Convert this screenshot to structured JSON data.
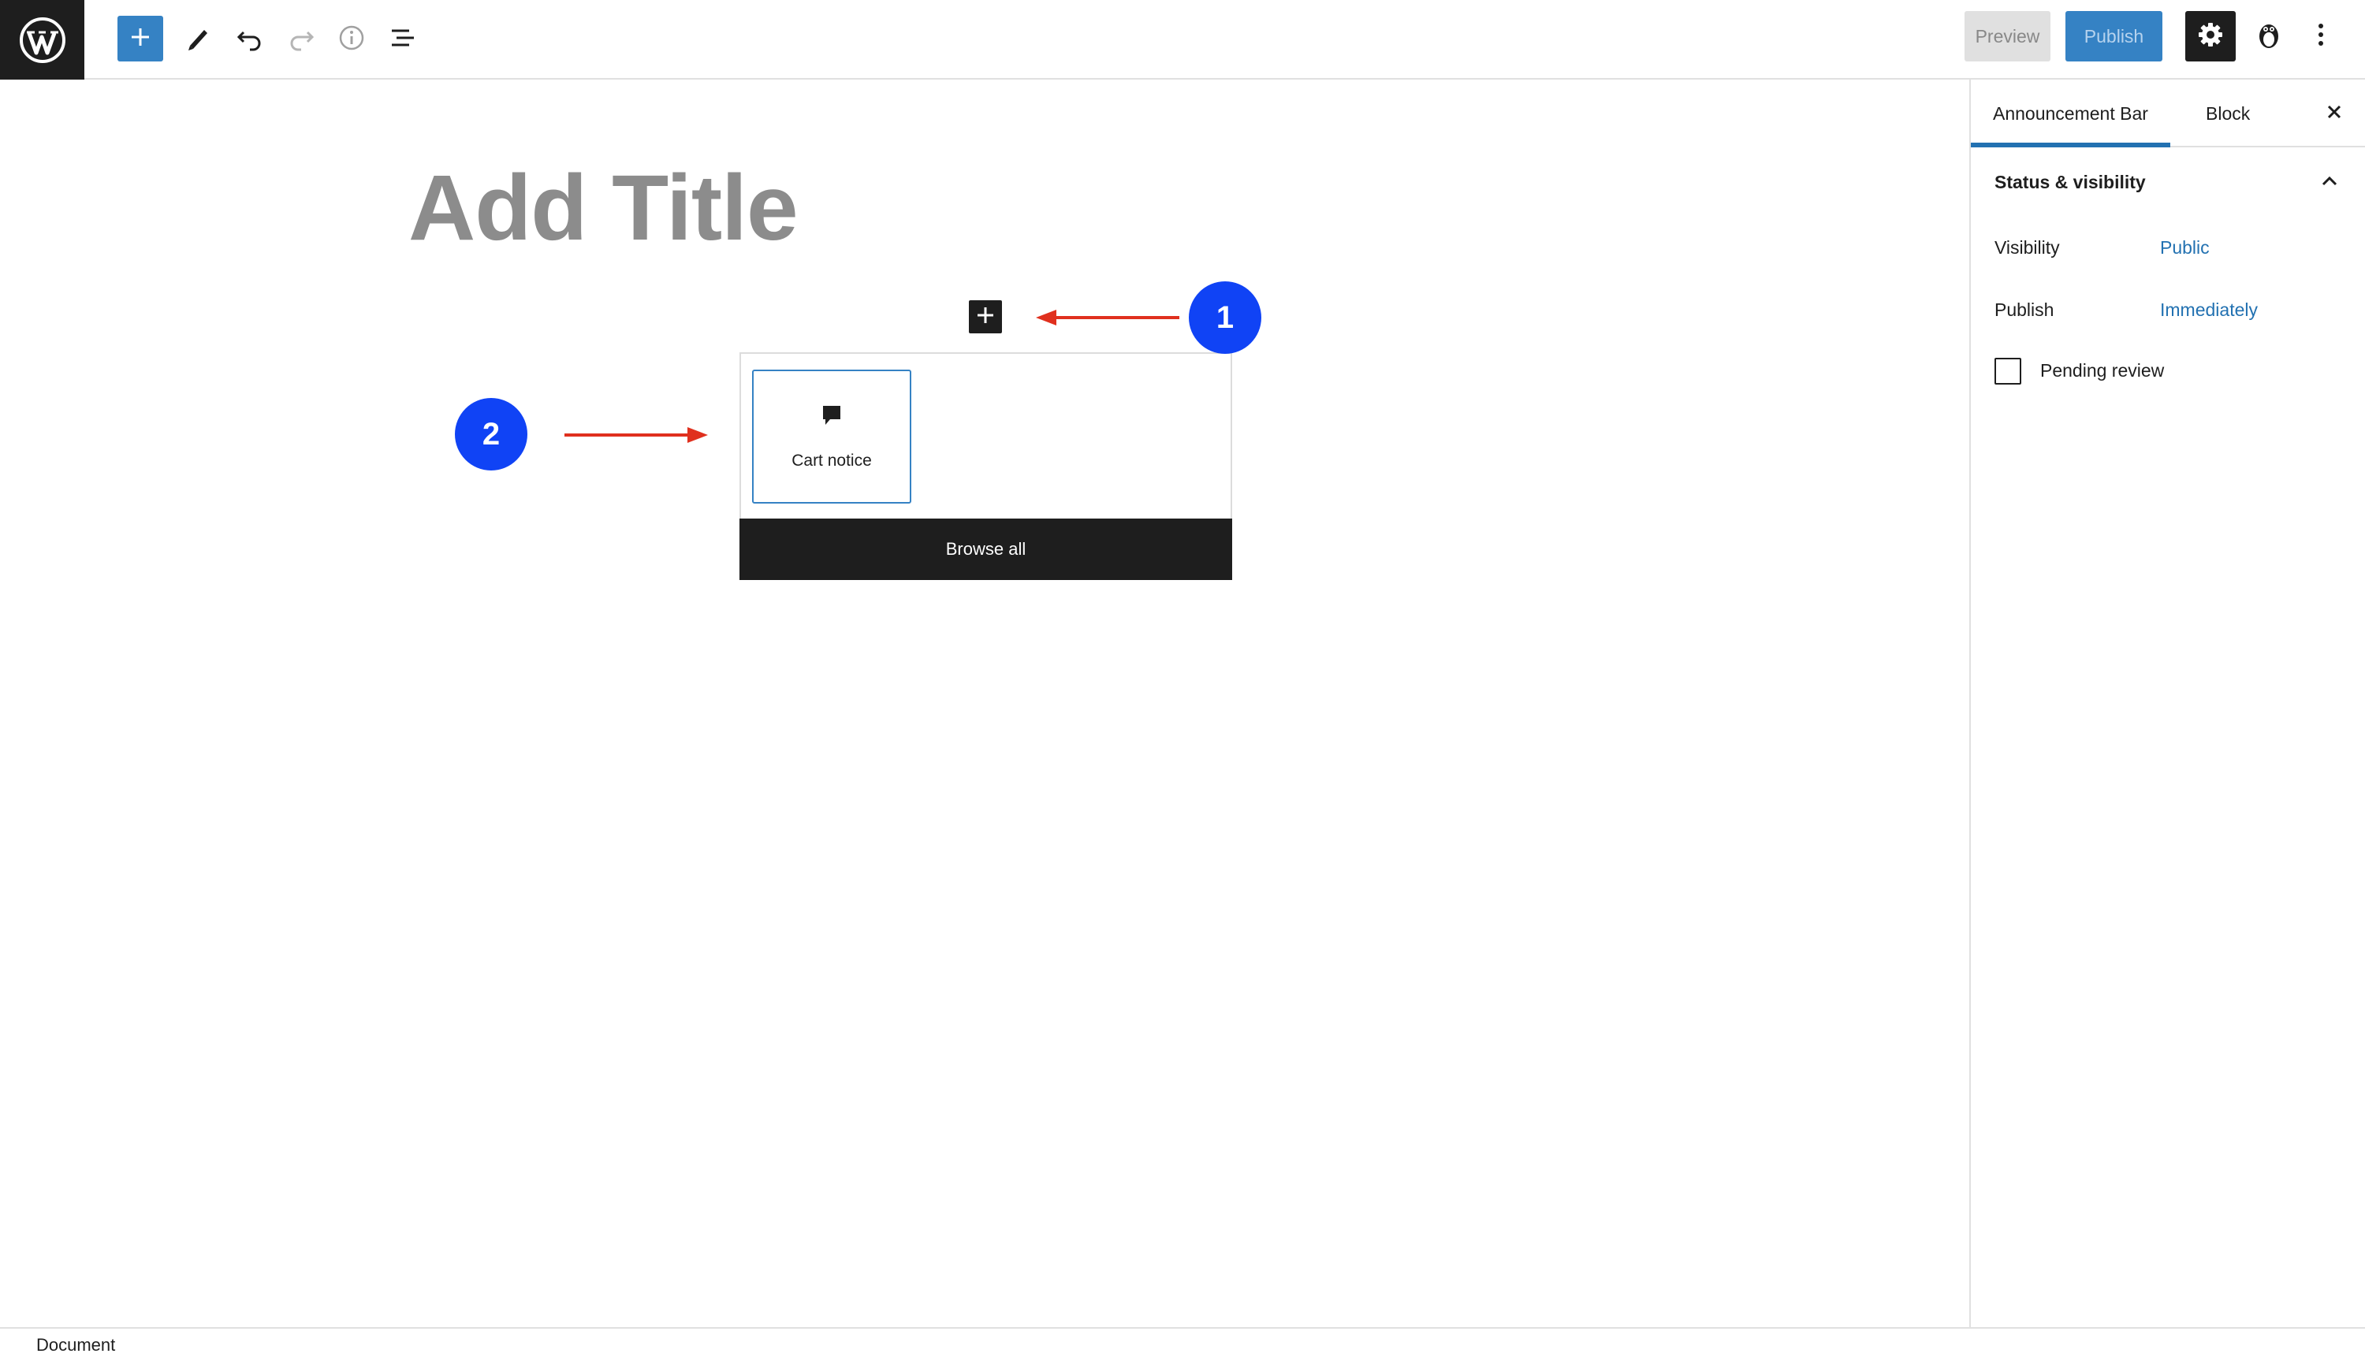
{
  "toolbar": {
    "preview_label": "Preview",
    "publish_label": "Publish"
  },
  "icons": {
    "logo": "wordpress-logo-icon",
    "inserter": "plus-icon",
    "tools": "pencil-icon",
    "undo": "undo-icon",
    "redo": "redo-icon",
    "details": "info-icon",
    "list_view": "list-view-icon",
    "settings": "gear-icon",
    "plugin": "penguin-plugin-icon",
    "more": "more-vertical-icon",
    "block": "speech-bubble-icon",
    "close": "close-icon",
    "chevron": "chevron-up-icon"
  },
  "colors": {
    "accent": "#3582c4",
    "annotation_badge": "#1043f5",
    "annotation_arrow": "#e0301e",
    "dark": "#1e1e1e",
    "link": "#2271b1"
  },
  "editor": {
    "title_placeholder": "Add Title"
  },
  "inserter": {
    "block_label": "Cart notice",
    "browse_all_label": "Browse all"
  },
  "annotations": {
    "badge1": "1",
    "badge2": "2"
  },
  "sidebar": {
    "tabs": [
      {
        "label": "Announcement Bar",
        "active": true
      },
      {
        "label": "Block",
        "active": false
      }
    ],
    "panel_title": "Status & visibility",
    "rows": [
      {
        "label": "Visibility",
        "value": "Public"
      },
      {
        "label": "Publish",
        "value": "Immediately"
      }
    ],
    "pending_review_label": "Pending review",
    "pending_review_checked": false
  },
  "footer": {
    "breadcrumb": "Document"
  }
}
